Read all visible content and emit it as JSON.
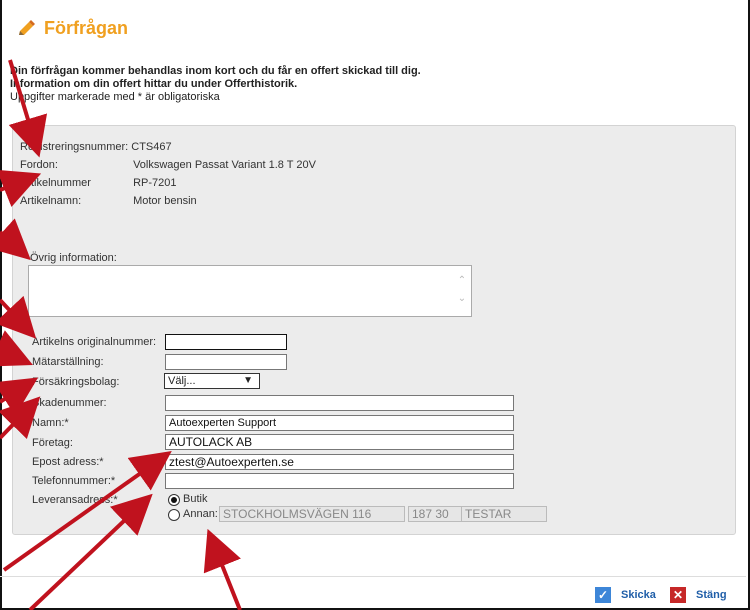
{
  "title": "Förfrågan",
  "message": {
    "line1": "Din förfrågan kommer behandlas inom kort och du får en offert skickad till dig.",
    "line2": "Information om din offert hittar du under Offerthistorik.",
    "line3": "Uppgifter markerade med * är obligatoriska"
  },
  "info": {
    "reg_label": "Registreringsnummer:",
    "reg_value": "CTS467",
    "fordon_label": "Fordon:",
    "fordon_value": "Volkswagen Passat Variant 1.8 T 20V",
    "artnr_label": "Artikelnummer",
    "artnr_value": "RP-7201",
    "artnamn_label": "Artikelnamn:",
    "artnamn_value": "Motor bensin"
  },
  "ovrig_label": "Övrig information:",
  "form": {
    "orig_label": "Artikelns originalnummer:",
    "matar_label": "Mätarställning:",
    "forsak_label": "Försäkringsbolag:",
    "forsak_value": "Välj...",
    "skade_label": "Skadenummer:",
    "namn_label": "Namn:*",
    "namn_value": "Autoexperten Support",
    "foretag_label": "Företag:",
    "foretag_value": "AUTOLACK AB",
    "epost_label": "Epost adress:*",
    "epost_value": "ztest@Autoexperten.se",
    "telefon_label": "Telefonnummer:*",
    "lev_label": "Leveransadress:*",
    "butik_label": "Butik",
    "annan_label": "Annan:",
    "annan_street": "STOCKHOLMSVÄGEN 116",
    "annan_zip": "187 30",
    "annan_city": "TESTAR"
  },
  "buttons": {
    "send": "Skicka",
    "close": "Stäng"
  },
  "colors": {
    "title": "#f0a020",
    "arrow": "#c0121e",
    "panel": "#ececec",
    "button_text": "#1f5ea8"
  }
}
